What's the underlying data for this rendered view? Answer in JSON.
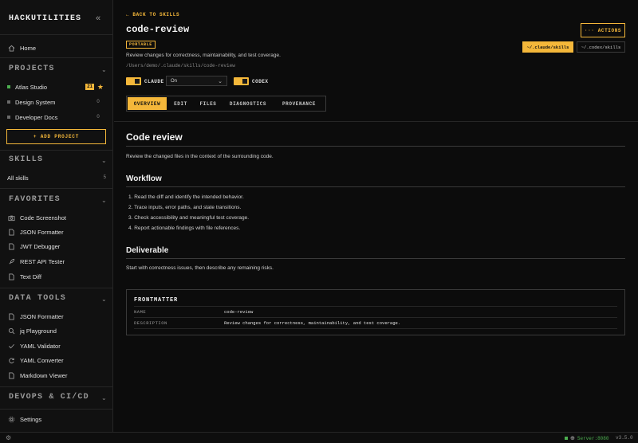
{
  "app": {
    "brand": "HACKUTILITIES",
    "collapse_icon": "double-chevron-left"
  },
  "sidebar": {
    "home": "Home",
    "projects_title": "PROJECTS",
    "projects": [
      {
        "name": "Atlas Studio",
        "badge": "21",
        "starred": true
      },
      {
        "name": "Design System",
        "count": "0"
      },
      {
        "name": "Developer Docs",
        "count": "0"
      }
    ],
    "add_project": "+ ADD PROJECT",
    "skills_title": "SKILLS",
    "all_skills": "All skills",
    "all_skills_count": "5",
    "favorites_title": "FAVORITES",
    "favorites": [
      "Code Screenshot",
      "JSON Formatter",
      "JWT Debugger",
      "REST API Tester",
      "Text Diff"
    ],
    "data_tools_title": "DATA TOOLS",
    "data_tools": [
      "JSON Formatter",
      "jq Playground",
      "YAML Validator",
      "YAML Converter",
      "Markdown Viewer"
    ],
    "devops_title": "DEVOPS & CI/CD",
    "settings": "Settings"
  },
  "header": {
    "back": "← BACK TO SKILLS",
    "title": "code-review",
    "badge": "PORTABLE",
    "description": "Review changes for correctness, maintainability, and test coverage.",
    "path": "/Users/demo/.claude/skills/code-review",
    "claude_label": "CLAUDE",
    "select_value": "On",
    "codex_label": "CODEX",
    "actions": "··· ACTIONS",
    "path_claude": "~/.claude/skills",
    "path_codex": "~/.codex/skills",
    "tabs": [
      "OVERVIEW",
      "EDIT",
      "FILES",
      "DIAGNOSTICS",
      "PROVENANCE"
    ]
  },
  "content": {
    "h1": "Code review",
    "intro": "Review the changed files in the context of the surrounding code.",
    "workflow_title": "Workflow",
    "workflow": [
      "1. Read the diff and identify the intended behavior.",
      "2. Trace inputs, error paths, and state transitions.",
      "3. Check accessibility and meaningful test coverage.",
      "4. Report actionable findings with file references."
    ],
    "deliverable_title": "Deliverable",
    "deliverable": "Start with correctness issues, then describe any remaining risks."
  },
  "frontmatter": {
    "title": "FRONTMATTER",
    "name_key": "NAME",
    "name_val": "code-review",
    "desc_key": "DESCRIPTION",
    "desc_val": "Review changes for correctness, maintainability, and test coverage."
  },
  "status": {
    "server": "Server:8080",
    "version": "v3.5.0"
  },
  "colors": {
    "accent": "#f4b73a",
    "online": "#4caf50",
    "background": "#0c0c0c"
  }
}
